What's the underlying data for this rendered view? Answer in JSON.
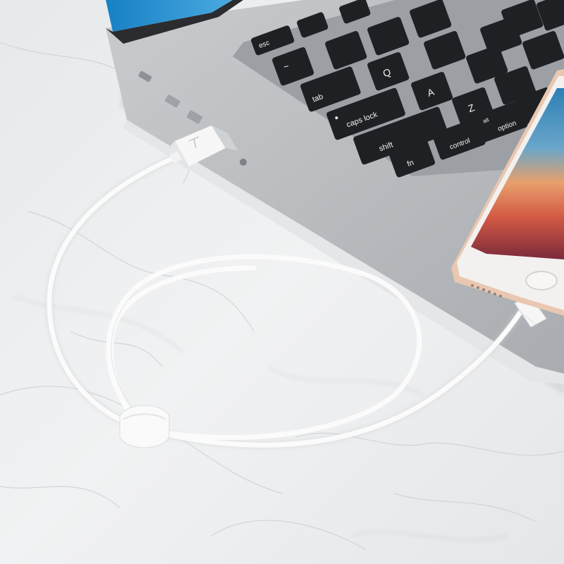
{
  "scene": {
    "colors": {
      "marble": "#eceeef",
      "laptop_body": "#b9bcbf",
      "key_cap": "#1f2023",
      "key_text": "#f2f2f2",
      "cable": "#fbfbfb",
      "phone_body": "#f3f1ef",
      "phone_frame": "#e9c7b0"
    },
    "keyboard": {
      "keys": {
        "esc": "esc",
        "tilde": "~",
        "tab": "tab",
        "q": "Q",
        "caps_lock": "caps lock",
        "a": "A",
        "shift": "shift",
        "z": "Z",
        "fn": "fn",
        "control": "control",
        "option_alt": "alt",
        "option": "option"
      }
    }
  }
}
